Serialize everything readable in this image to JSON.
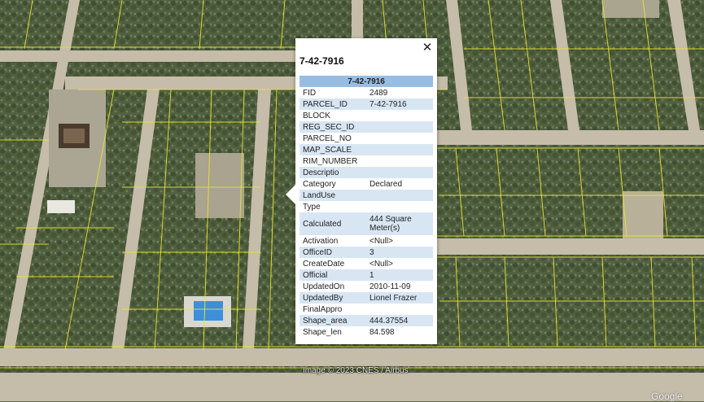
{
  "map": {
    "credit": "Image © 2023 CNES / Airbus",
    "wordmark": "Google"
  },
  "popup": {
    "title": "7-42-7916",
    "table_header": "7-42-7916",
    "close_label": "✕",
    "rows": [
      {
        "key": "FID",
        "value": "2489"
      },
      {
        "key": "PARCEL_ID",
        "value": "7-42-7916"
      },
      {
        "key": "BLOCK",
        "value": ""
      },
      {
        "key": "REG_SEC_ID",
        "value": ""
      },
      {
        "key": "PARCEL_NO",
        "value": ""
      },
      {
        "key": "MAP_SCALE",
        "value": ""
      },
      {
        "key": "RIM_NUMBER",
        "value": ""
      },
      {
        "key": "Descriptio",
        "value": ""
      },
      {
        "key": "Category",
        "value": "Declared"
      },
      {
        "key": "LandUse",
        "value": ""
      },
      {
        "key": "Type",
        "value": ""
      },
      {
        "key": "Calculated",
        "value": "444 Square Meter(s)"
      },
      {
        "key": "Activation",
        "value": "<Null>"
      },
      {
        "key": "OfficeID",
        "value": "3"
      },
      {
        "key": "CreateDate",
        "value": "<Null>"
      },
      {
        "key": "Official",
        "value": "1"
      },
      {
        "key": "UpdatedOn",
        "value": "2010-11-09"
      },
      {
        "key": "UpdatedBy",
        "value": "Lionel Frazer"
      },
      {
        "key": "FinalAppro",
        "value": ""
      },
      {
        "key": "Shape_area",
        "value": "444.37554"
      },
      {
        "key": "Shape_len",
        "value": "84.598"
      }
    ]
  },
  "colors": {
    "parcel_line": "#e6e62a",
    "header_fill": "#98bde0",
    "alt_row_fill": "#d8e6f3"
  }
}
